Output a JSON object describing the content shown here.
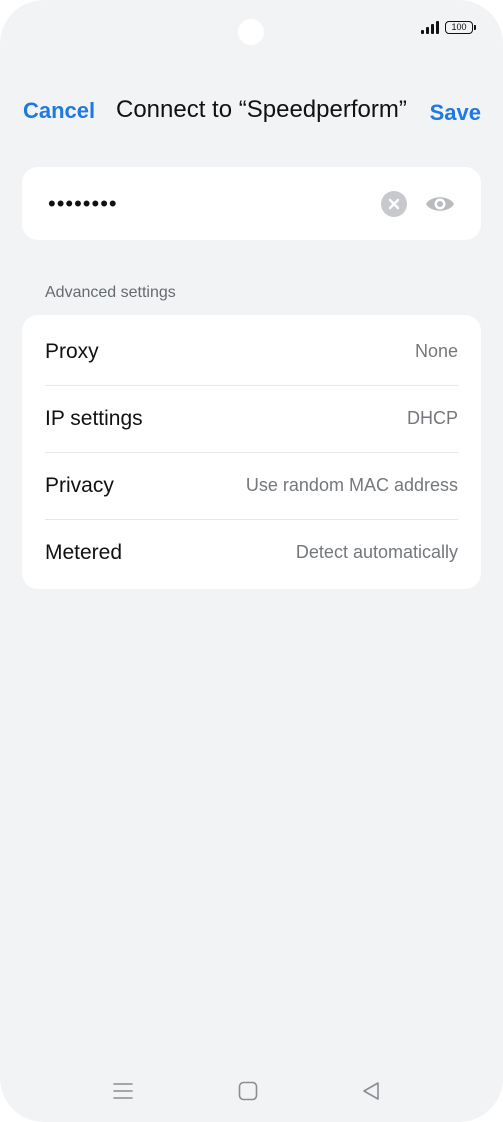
{
  "status_bar": {
    "battery_level": "100",
    "signal_icon": "signal-bars-icon"
  },
  "header": {
    "cancel_label": "Cancel",
    "title": "Connect to “Speedperform”",
    "save_label": "Save"
  },
  "password": {
    "value": "••••••••",
    "clear_icon": "clear-icon",
    "visibility_icon": "eye-icon"
  },
  "advanced": {
    "section_label": "Advanced settings",
    "rows": [
      {
        "label": "Proxy",
        "value": "None"
      },
      {
        "label": "IP settings",
        "value": "DHCP"
      },
      {
        "label": "Privacy",
        "value": "Use random MAC address"
      },
      {
        "label": "Metered",
        "value": "Detect automatically"
      }
    ]
  },
  "navigation": {
    "menu_icon": "menu-icon",
    "home_icon": "home-icon",
    "back_icon": "back-icon"
  },
  "colors": {
    "accent": "#1f7ae0",
    "background": "#f2f3f5",
    "card": "#ffffff"
  }
}
